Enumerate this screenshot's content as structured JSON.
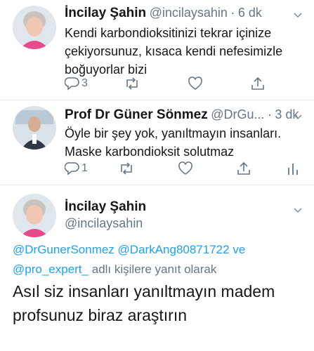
{
  "tweets": [
    {
      "name": "İncilay Şahin",
      "handle": "@incilaysahin",
      "time": "6 dk",
      "lines": [
        "Kendi karbondioksitinizi tekrar  içinize",
        "çekiyorsunuz, kısaca kendi nefesimizle",
        "boğuyorlar bizi"
      ],
      "reply_count": "3",
      "retweet_count": "",
      "like_count": ""
    },
    {
      "name": "Prof Dr Güner Sönmez",
      "handle": "@DrGu...",
      "time": "3 dk",
      "lines": [
        "Öyle bir şey yok, yanıltmayın insanları.",
        "Maske karbondioksit solutmaz"
      ],
      "reply_count": "1",
      "retweet_count": "",
      "like_count": ""
    }
  ],
  "main_tweet": {
    "name": "İncilay Şahin",
    "handle": "@incilaysahin",
    "replying_mentions": [
      "@DrGunerSonmez",
      "@DarkAng80871722",
      "@pro_expert_"
    ],
    "replying_connector": "ve",
    "replying_suffix": "adlı kişilere yanıt olarak",
    "lines": [
      "Asıl siz insanları yanıltmayın madem",
      "profsunuz biraz araştırın"
    ]
  },
  "icons": [
    "reply-icon",
    "retweet-icon",
    "like-icon",
    "share-icon",
    "analytics-icon",
    "chevron-down-icon"
  ],
  "colors": {
    "link": "#1da1f2",
    "secondary": "#657786",
    "primary": "#14171a"
  }
}
